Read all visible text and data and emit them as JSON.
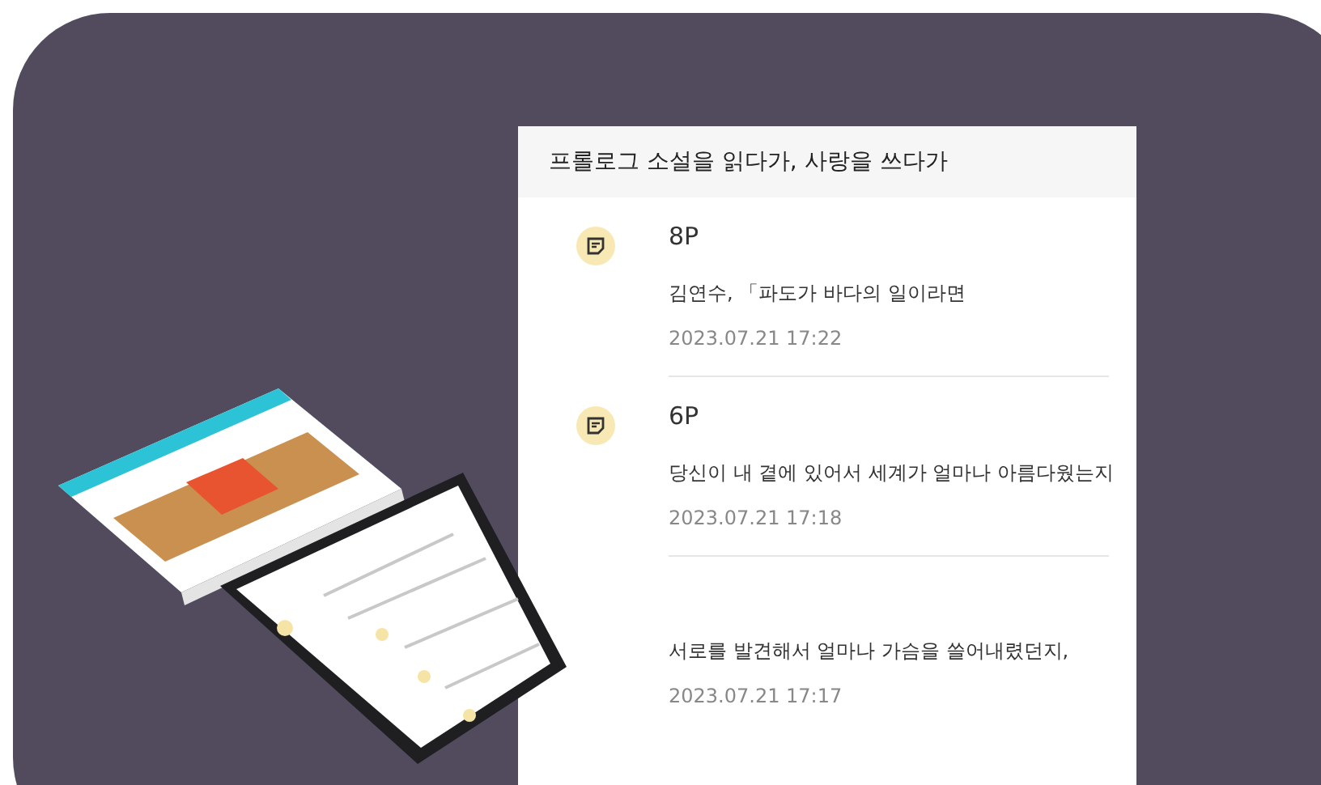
{
  "card": {
    "title": "프롤로그 소설을 읽다가, 사랑을 쓰다가",
    "notes": [
      {
        "page": "8P",
        "text": "김연수, 「파도가 바다의 일이라면",
        "date": "2023.07.21 17:22"
      },
      {
        "page": "6P",
        "text": "당신이 내 곁에 있어서 세계가 얼마나 아름다웠는지",
        "date": "2023.07.21 17:18"
      },
      {
        "text": "서로를 발견해서 얼마나 가슴을 쓸어내렸던지,",
        "date": "2023.07.21 17:17"
      }
    ]
  }
}
